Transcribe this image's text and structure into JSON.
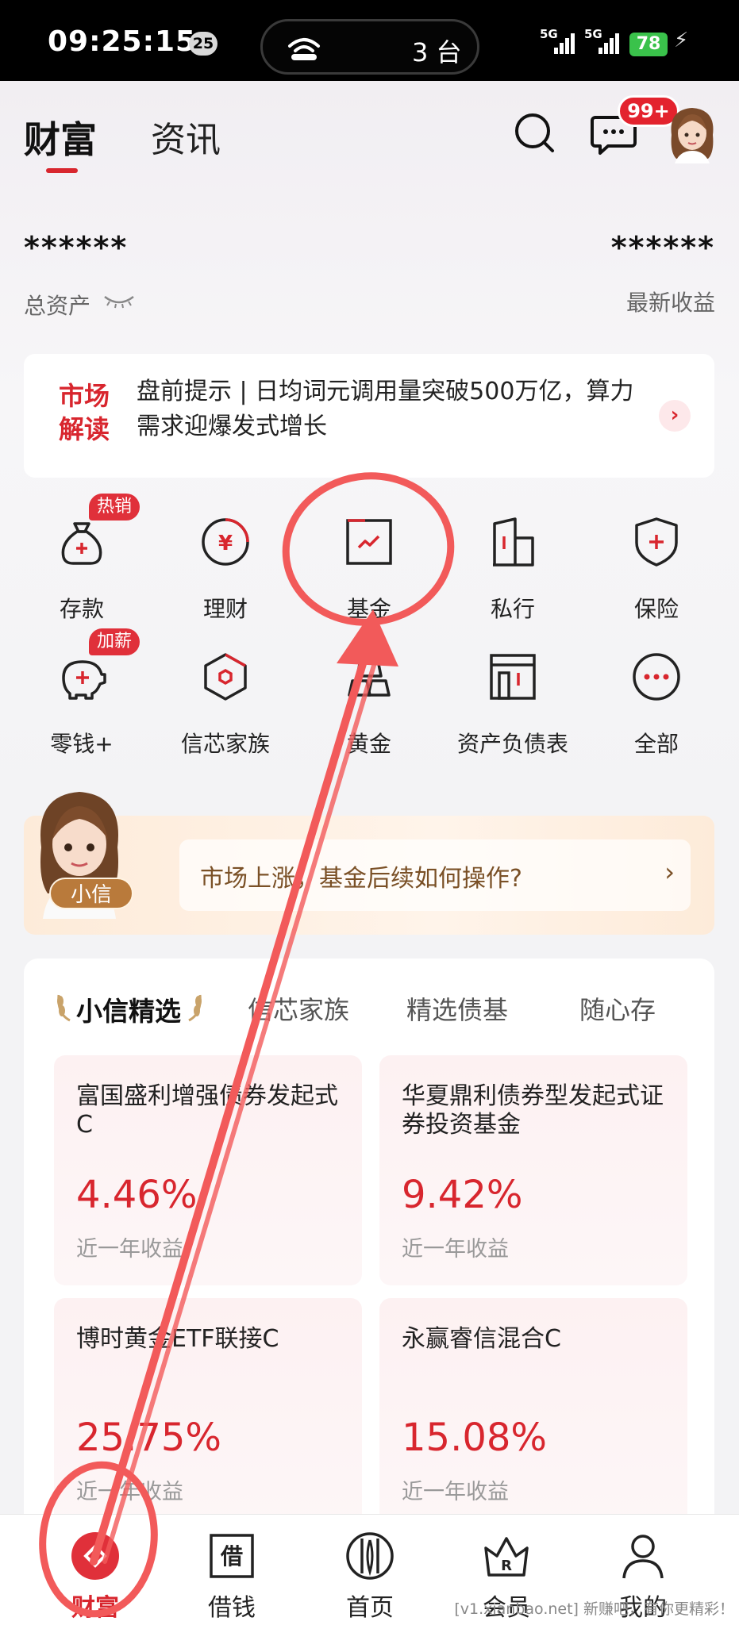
{
  "status_bar": {
    "time": "09:25:15",
    "notif_count": "25",
    "island_text": "3 台",
    "signal1": "5G",
    "signal2": "5G",
    "battery": "78"
  },
  "header": {
    "tab_wealth": "财富",
    "tab_news": "资讯",
    "message_badge": "99+"
  },
  "assets": {
    "total_masked": "******",
    "total_label": "总资产",
    "earnings_masked": "******",
    "earnings_label": "最新收益"
  },
  "market": {
    "tag_line1": "市场",
    "tag_line2": "解读",
    "text": "盘前提示 | 日均词元调用量突破500万亿，算力需求迎爆发式增长"
  },
  "grid": [
    {
      "label": "存款",
      "badge": "热销",
      "icon": "money-bag-icon"
    },
    {
      "label": "理财",
      "badge": "",
      "icon": "yuan-coin-icon"
    },
    {
      "label": "基金",
      "badge": "",
      "icon": "fund-chart-icon"
    },
    {
      "label": "私行",
      "badge": "",
      "icon": "building-icon"
    },
    {
      "label": "保险",
      "badge": "",
      "icon": "shield-plus-icon"
    },
    {
      "label": "零钱+",
      "badge": "加薪",
      "icon": "piggy-bank-icon"
    },
    {
      "label": "信芯家族",
      "badge": "",
      "icon": "hexagon-icon"
    },
    {
      "label": "黄金",
      "badge": "",
      "icon": "gold-bar-icon"
    },
    {
      "label": "资产负债表",
      "badge": "",
      "icon": "balance-sheet-icon"
    },
    {
      "label": "全部",
      "badge": "",
      "icon": "more-dots-icon"
    }
  ],
  "assistant": {
    "name": "小信",
    "prompt": "市场上涨，基金后续如何操作?"
  },
  "picks": {
    "tabs": [
      "小信精选",
      "信芯家族",
      "精选债基",
      "随心存"
    ],
    "funds": [
      {
        "name": "富国盛利增强债券发起式C",
        "rate": "4.46%",
        "note": "近一年收益"
      },
      {
        "name": "华夏鼎利债券型发起式证券投资基金",
        "rate": "9.42%",
        "note": "近一年收益"
      },
      {
        "name": "博时黄金ETF联接C",
        "rate": "25.75%",
        "note": "近一年收益"
      },
      {
        "name": "永赢睿信混合C",
        "rate": "15.08%",
        "note": "近一年收益"
      }
    ]
  },
  "bottom_nav": [
    {
      "label": "财富",
      "active": true
    },
    {
      "label": "借钱",
      "active": false
    },
    {
      "label": "首页",
      "active": false
    },
    {
      "label": "会员",
      "active": false
    },
    {
      "label": "我的",
      "active": false
    }
  ],
  "watermark": "[v1.xianbao.net] 新赚吧，有你更精彩！",
  "colors": {
    "brand_red": "#d8262e",
    "annotation_red": "#f25a5a",
    "battery_green": "#3ac24b"
  }
}
